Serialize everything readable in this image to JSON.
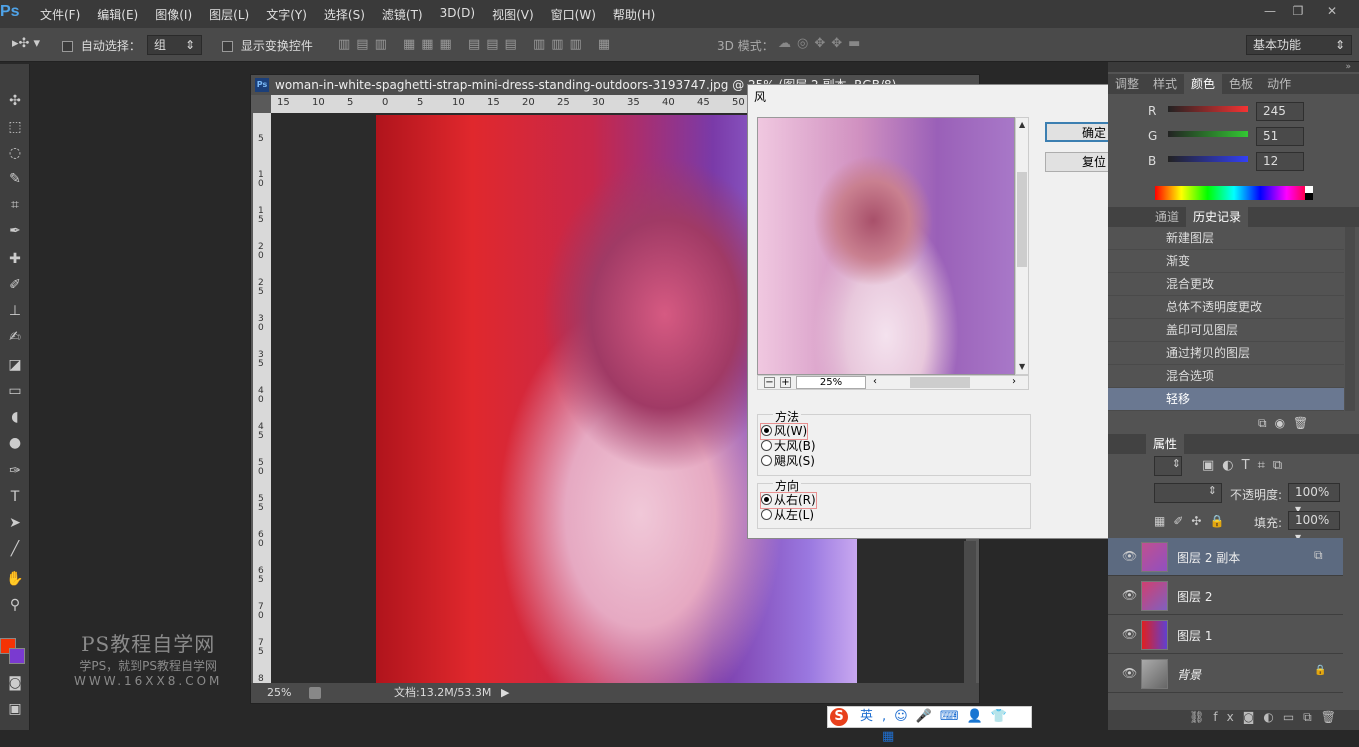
{
  "app": {
    "logo": "Ps"
  },
  "menu": [
    "文件(F)",
    "编辑(E)",
    "图像(I)",
    "图层(L)",
    "文字(Y)",
    "选择(S)",
    "滤镜(T)",
    "3D(D)",
    "视图(V)",
    "窗口(W)",
    "帮助(H)"
  ],
  "window_controls": {
    "minimize": "—",
    "restore": "❐",
    "close": "✕"
  },
  "options": {
    "auto_select_label": "自动选择：",
    "auto_select_value": "组",
    "show_transform_label": "显示变换控件",
    "mode3d_label": "3D 模式：",
    "workspace": "基本功能"
  },
  "document": {
    "title": "woman-in-white-spaghetti-strap-mini-dress-standing-outdoors-3193747.jpg @ 25% (图层 2 副本, RGB/8)",
    "ruler_h": [
      "15",
      "10",
      "5",
      "0",
      "5",
      "10",
      "15",
      "20",
      "25",
      "30",
      "35",
      "40",
      "45",
      "50"
    ],
    "ruler_v": [
      "5",
      "1 0",
      "1 5",
      "2 0",
      "2 5",
      "3 0",
      "3 5",
      "4 0",
      "4 5",
      "5 0",
      "5 5",
      "6 0",
      "6 5",
      "7 0",
      "7 5",
      "8"
    ],
    "zoom": "25%",
    "doc_info": "文档:13.2M/53.3M"
  },
  "dialog": {
    "title": "风",
    "ok": "确定",
    "reset": "复位",
    "preview_zoom": "25%",
    "method_label": "方法",
    "method_options": [
      "风(W)",
      "大风(B)",
      "飓风(S)"
    ],
    "method_selected": 0,
    "direction_label": "方向",
    "direction_options": [
      "从右(R)",
      "从左(L)"
    ],
    "direction_selected": 0
  },
  "color_panel": {
    "tabs": [
      "调整",
      "样式",
      "颜色",
      "色板",
      "动作"
    ],
    "active_tab": "颜色",
    "channels": [
      {
        "label": "R",
        "value": "245",
        "color": "#f53333"
      },
      {
        "label": "G",
        "value": "51",
        "color": "#33c833"
      },
      {
        "label": "B",
        "value": "12",
        "color": "#3340f5"
      }
    ]
  },
  "history_panel": {
    "tabs": [
      "通道",
      "历史记录"
    ],
    "active_tab": "历史记录",
    "items": [
      "新建图层",
      "渐变",
      "混合更改",
      "总体不透明度更改",
      "盖印可见图层",
      "通过拷贝的图层",
      "混合选项",
      "轻移"
    ],
    "selected_index": 7
  },
  "layers_panel": {
    "tab": "属性",
    "opacity_label": "不透明度:",
    "opacity_value": "100%",
    "fill_label": "填充:",
    "fill_value": "100%",
    "layers": [
      {
        "name": "图层 2 副本",
        "selected": true
      },
      {
        "name": "图层 2",
        "selected": false
      },
      {
        "name": "图层 1",
        "selected": false
      },
      {
        "name": "背景",
        "selected": false,
        "locked": true
      }
    ]
  },
  "watermark": {
    "line1": "PS教程自学网",
    "line2": "学PS，就到PS教程自学网",
    "line3": "WWW.16XX8.COM"
  },
  "ime": {
    "label": "英"
  },
  "colors": {
    "foreground": "#f53305",
    "background": "#7a3ad0"
  }
}
